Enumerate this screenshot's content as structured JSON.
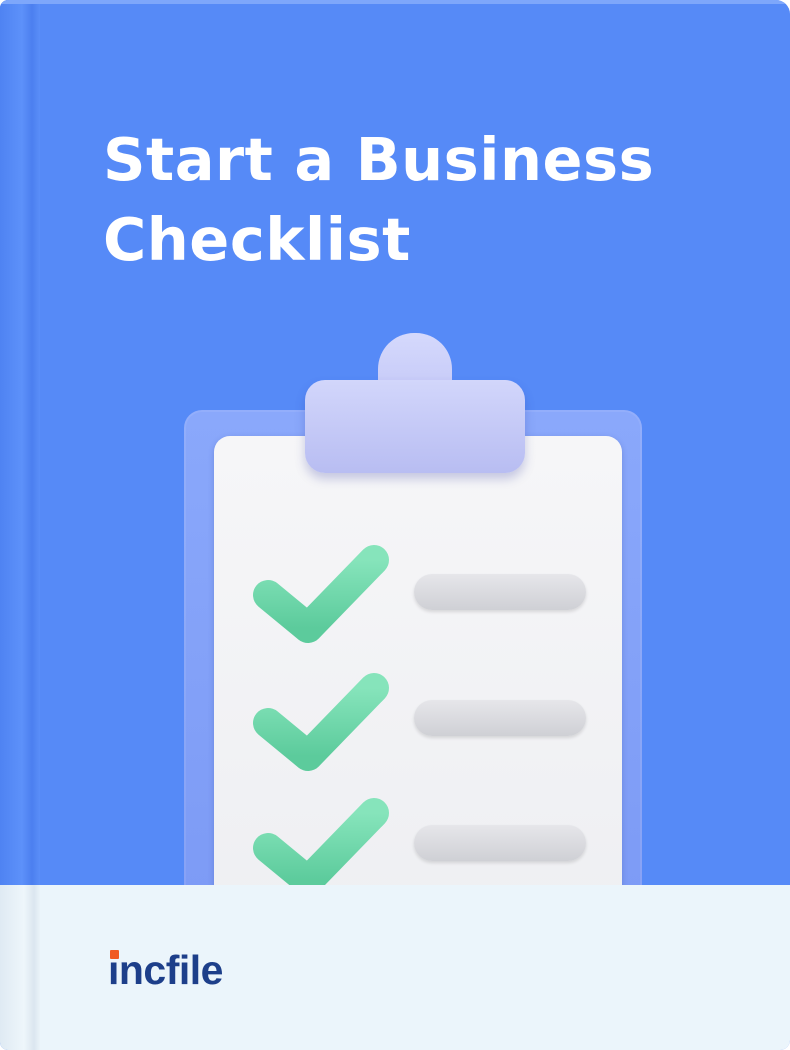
{
  "cover": {
    "title_line1": "Start a Business",
    "title_line2": "Checklist",
    "brand": "incfile",
    "background_color": "#568af7",
    "footer_color": "#ebf5fb",
    "brand_color": "#1d3f8a",
    "brand_accent_color": "#f05a22",
    "illustration": {
      "name": "clipboard-checklist-icon",
      "items_checked": 3,
      "check_color": "#6fd8a9"
    }
  }
}
